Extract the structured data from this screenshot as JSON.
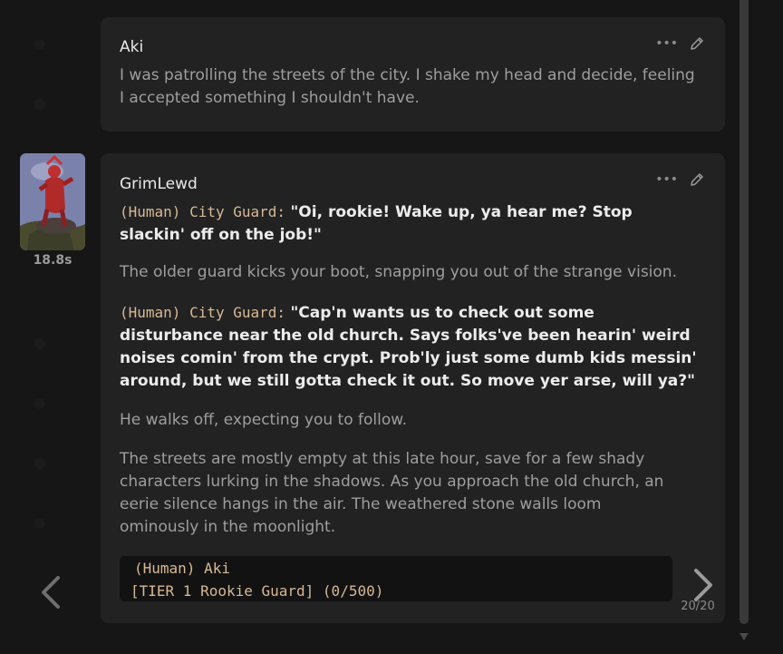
{
  "messages": [
    {
      "author": "Aki",
      "text": "I was patrolling the streets of the city. I shake my head and decide, feeling I accepted something I shouldn't have."
    },
    {
      "author": "GrimLewd",
      "timer": "18.8s",
      "paragraphs": [
        {
          "tag": "(Human) City Guard:",
          "speech": "\"Oi, rookie! Wake up, ya hear me? Stop slackin' off on the job!\""
        },
        {
          "narration": "The older guard kicks your boot, snapping you out of the strange vision."
        },
        {
          "tag": "(Human) City Guard:",
          "speech": "\"Cap'n wants us to check out some disturbance near the old church. Says folks've been hearin' weird noises comin' from the crypt. Prob'ly just some dumb kids messin' around, but we still gotta check it out. So move yer arse, will ya?\""
        },
        {
          "narration": "He walks off, expecting you to follow."
        },
        {
          "narration": "The streets are mostly empty at this late hour, save for a few shady characters lurking in the shadows. As you approach the old church, an eerie silence hangs in the air. The weathered stone walls loom ominously in the moonlight."
        }
      ],
      "status_block": {
        "line1": "(Human) Aki",
        "line2": "[TIER 1 Rookie Guard] (0/500)"
      },
      "swipe_counter": "20/20"
    }
  ],
  "icons": {
    "more": "more-dots-icon",
    "edit": "pencil-icon",
    "prev": "chevron-left-icon",
    "next": "chevron-right-icon",
    "scroll": "triangle-down-icon"
  },
  "colors": {
    "background": "#161616",
    "card": "#222222",
    "tag": "#d8b894",
    "narration": "#9e9e9e",
    "speech": "#ececec"
  }
}
